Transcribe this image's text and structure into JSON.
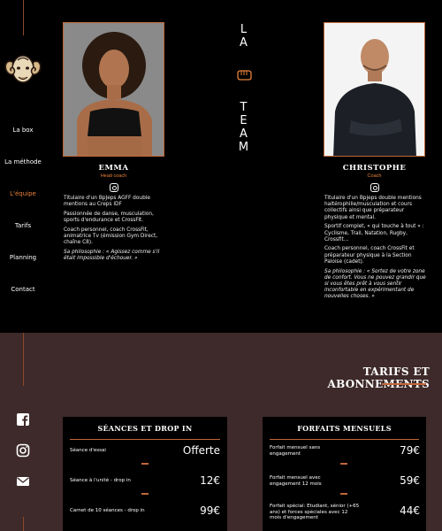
{
  "nav": {
    "items": [
      {
        "label": "La box",
        "active": false
      },
      {
        "label": "La méthode",
        "active": false
      },
      {
        "label": "L'équipe",
        "active": true
      },
      {
        "label": "Tarifs",
        "active": false
      },
      {
        "label": "Planning",
        "active": false
      },
      {
        "label": "Contact",
        "active": false
      }
    ]
  },
  "team": {
    "title_letters": [
      "L",
      "A",
      "T",
      "E",
      "A",
      "M"
    ],
    "coaches": [
      {
        "name": "EMMA",
        "role": "Head coach",
        "bio": [
          "Titulaire d'un BpJeps AGFF double mentions au Creps IDF",
          "Passionnée de danse, musculation, sports d'endurance et CrossFit.",
          "Coach personnel, coach CrossFit, animatrice Tv (émission Gym Direct, chaîne C8).",
          "Sa philosophie : « Agissez comme s'il était impossible d'échouer. »"
        ]
      },
      {
        "name": "CHRISTOPHE",
        "role": "Coach",
        "bio": [
          "Titulaire d'un Bpjeps double mentions haltérophilie/musculation et cours collectifs ainsi que préparateur physique et mental.",
          "Sportif complet, « qui touche à tout » : Cyclisme, Trail, Natation, Rugby, Crossfit…",
          "Coach personnel, coach CrossFit et préparateur physique à la Section Paloise (cadet).",
          "Sa philosophie : « Sortez de votre zone de confort. Vous ne pouvez grandir que si vous êtes prêt à vous sentir inconfortable en expérimentant de nouvelles choses. »"
        ]
      }
    ]
  },
  "pricing": {
    "title": "TARIFS ET ABONNEMENTS",
    "panels": [
      {
        "title": "SÉANCES ET DROP IN",
        "rows": [
          {
            "label": "Séance d'essai",
            "price": "Offerte"
          },
          {
            "label": "Séance à l'unité - drop in",
            "price": "12€"
          },
          {
            "label": "Carnet de 10 séances - drop in",
            "price": "99€"
          }
        ]
      },
      {
        "title": "FORFAITS MENSUELS",
        "rows": [
          {
            "label": "Forfait mensuel sans engagement",
            "price": "79€"
          },
          {
            "label": "Forfait mensuel avec engagement 12 mois",
            "price": "59€"
          },
          {
            "label": "Forfait spécial: Etudiant, sénior (+65 ans) et forces spéciales avec 12 mois d'engagement",
            "price": "44€"
          }
        ]
      }
    ]
  },
  "colors": {
    "accent": "#e8823a",
    "line": "#c0673a",
    "bottom_bg": "#3e2a2a"
  }
}
